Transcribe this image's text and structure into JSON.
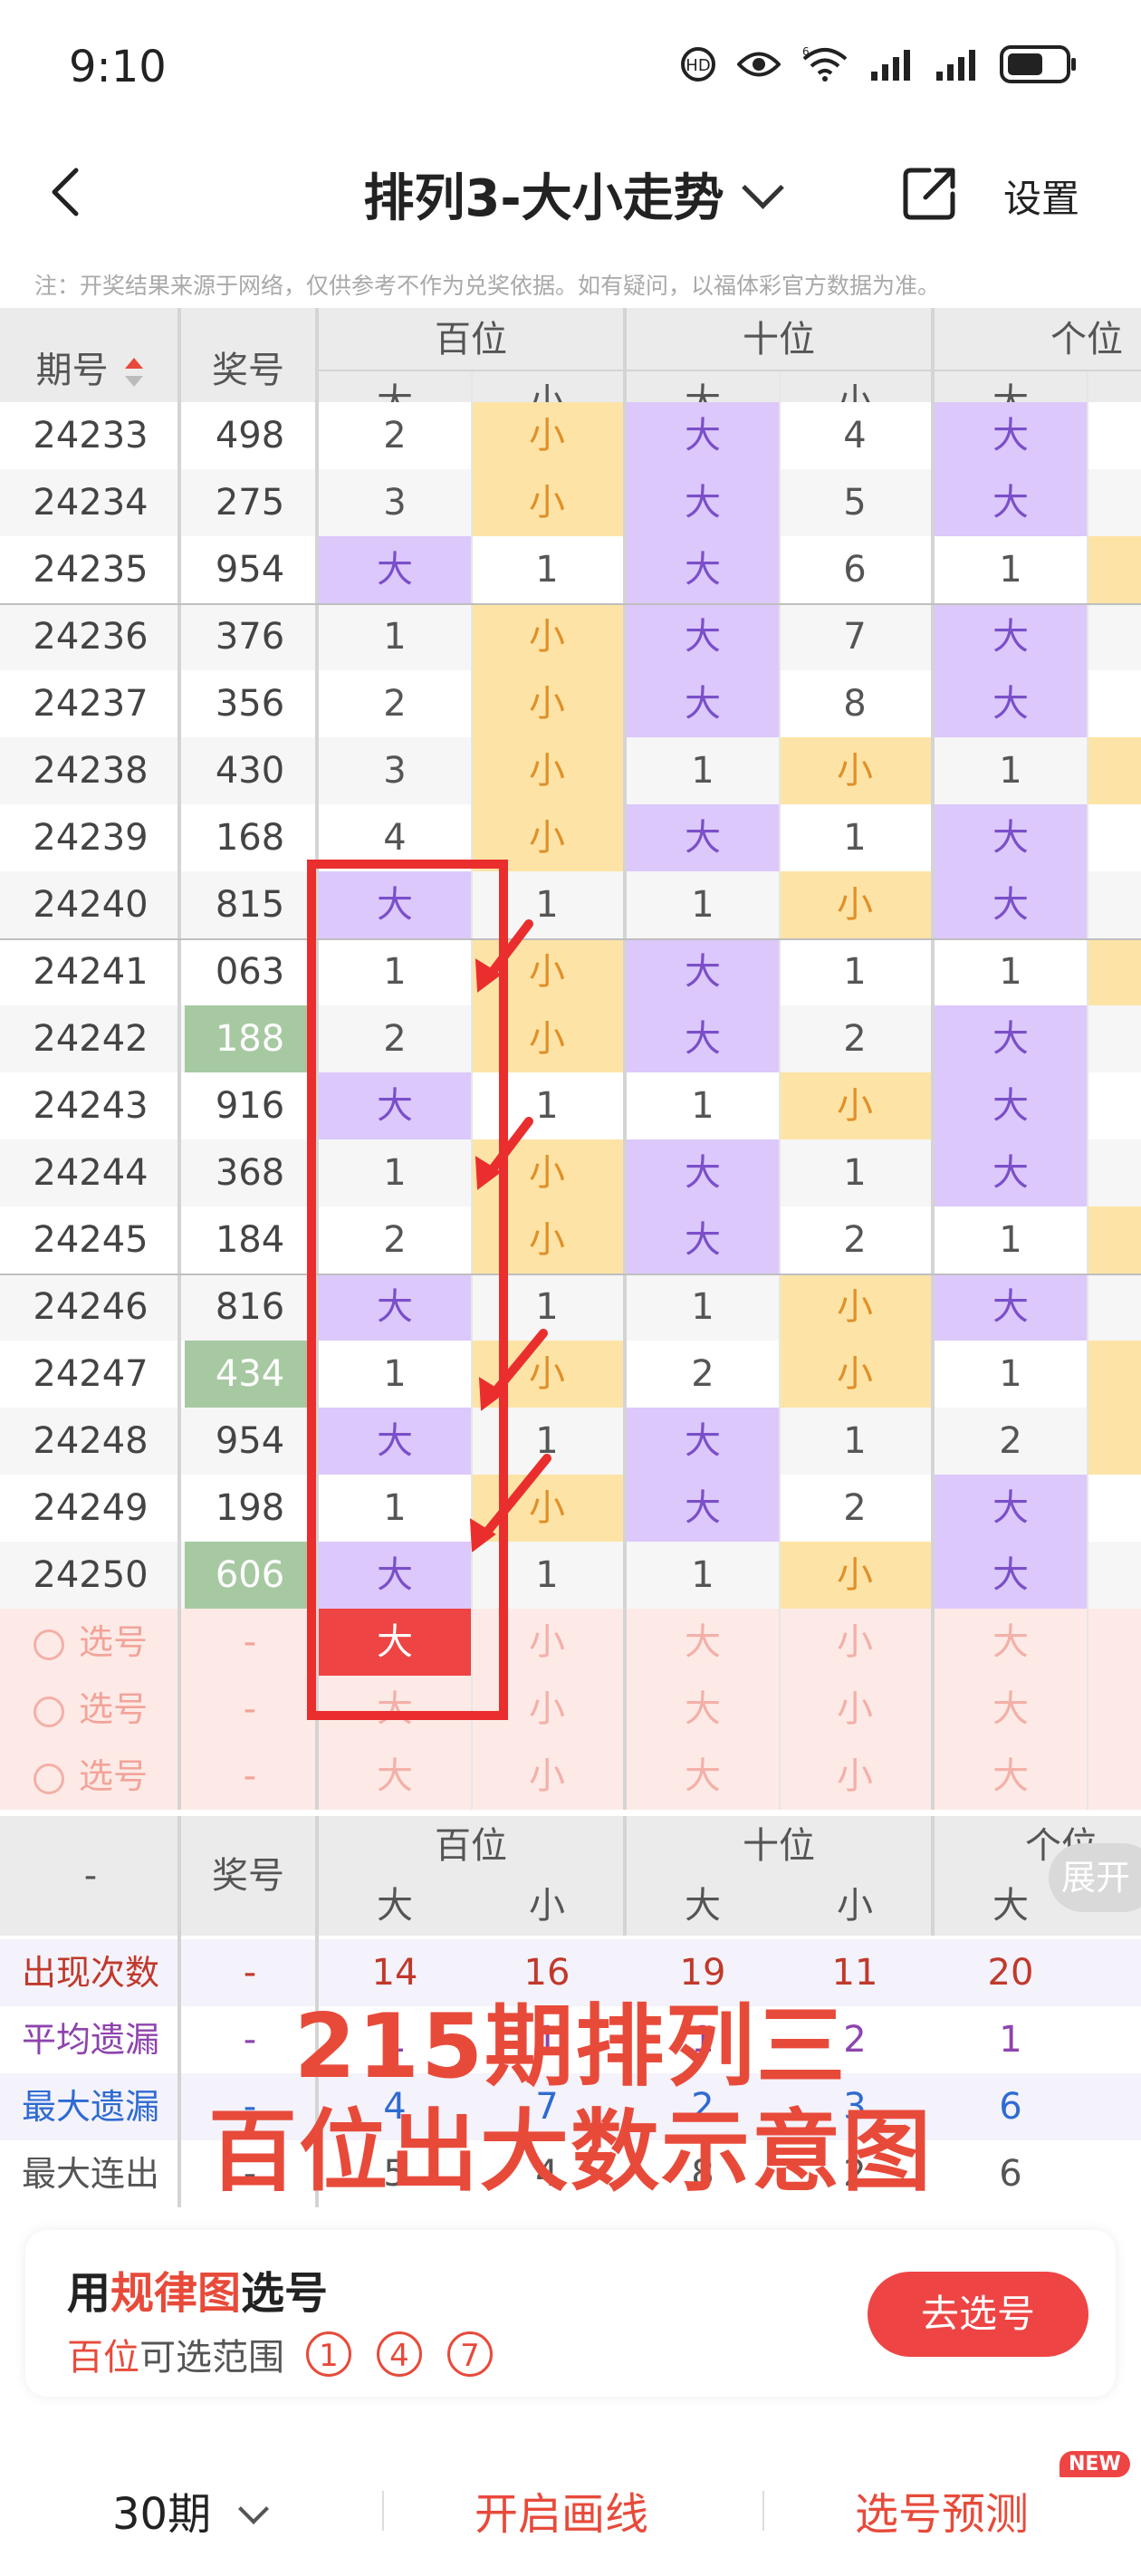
{
  "status": {
    "time": "9:10",
    "network": "6",
    "battery": "battery"
  },
  "nav": {
    "title": "排列3-大小走势",
    "settings": "设置"
  },
  "note": "注：开奖结果来源于网络，仅供参考不作为兑奖依据。如有疑问，以福体彩官方数据为准。",
  "header": {
    "period": "期号",
    "prize": "奖号",
    "groups": [
      "百位",
      "十位",
      "个位"
    ],
    "sub": [
      "大",
      "小",
      "大",
      "小",
      "大"
    ]
  },
  "rows": [
    {
      "p": "24233",
      "n": "498",
      "w": false,
      "c": [
        "2",
        "小",
        "大",
        "4",
        "大"
      ]
    },
    {
      "p": "24234",
      "n": "275",
      "w": false,
      "c": [
        "3",
        "小",
        "大",
        "5",
        "大"
      ]
    },
    {
      "p": "24235",
      "n": "954",
      "w": false,
      "c": [
        "大",
        "1",
        "大",
        "6",
        "1"
      ]
    },
    {
      "p": "24236",
      "n": "376",
      "w": false,
      "c": [
        "1",
        "小",
        "大",
        "7",
        "大"
      ]
    },
    {
      "p": "24237",
      "n": "356",
      "w": false,
      "c": [
        "2",
        "小",
        "大",
        "8",
        "大"
      ]
    },
    {
      "p": "24238",
      "n": "430",
      "w": false,
      "c": [
        "3",
        "小",
        "1",
        "小",
        "1"
      ]
    },
    {
      "p": "24239",
      "n": "168",
      "w": false,
      "c": [
        "4",
        "小",
        "大",
        "1",
        "大"
      ]
    },
    {
      "p": "24240",
      "n": "815",
      "w": false,
      "c": [
        "大",
        "1",
        "1",
        "小",
        "大"
      ]
    },
    {
      "p": "24241",
      "n": "063",
      "w": false,
      "c": [
        "1",
        "小",
        "大",
        "1",
        "1"
      ]
    },
    {
      "p": "24242",
      "n": "188",
      "w": true,
      "c": [
        "2",
        "小",
        "大",
        "2",
        "大"
      ]
    },
    {
      "p": "24243",
      "n": "916",
      "w": false,
      "c": [
        "大",
        "1",
        "1",
        "小",
        "大"
      ]
    },
    {
      "p": "24244",
      "n": "368",
      "w": false,
      "c": [
        "1",
        "小",
        "大",
        "1",
        "大"
      ]
    },
    {
      "p": "24245",
      "n": "184",
      "w": false,
      "c": [
        "2",
        "小",
        "大",
        "2",
        "1"
      ]
    },
    {
      "p": "24246",
      "n": "816",
      "w": false,
      "c": [
        "大",
        "1",
        "1",
        "小",
        "大"
      ]
    },
    {
      "p": "24247",
      "n": "434",
      "w": true,
      "c": [
        "1",
        "小",
        "2",
        "小",
        "1"
      ]
    },
    {
      "p": "24248",
      "n": "954",
      "w": false,
      "c": [
        "大",
        "1",
        "大",
        "1",
        "2"
      ]
    },
    {
      "p": "24249",
      "n": "198",
      "w": false,
      "c": [
        "1",
        "小",
        "大",
        "2",
        "大"
      ]
    },
    {
      "p": "24250",
      "n": "606",
      "w": true,
      "c": [
        "大",
        "1",
        "1",
        "小",
        "大"
      ]
    }
  ],
  "select_rows": [
    {
      "label": "选号",
      "dash": "-",
      "c": [
        "大",
        "小",
        "大",
        "小",
        "大"
      ]
    },
    {
      "label": "选号",
      "dash": "-",
      "c": [
        "大",
        "小",
        "大",
        "小",
        "大"
      ]
    },
    {
      "label": "选号",
      "dash": "-",
      "c": [
        "大",
        "小",
        "大",
        "小",
        "大"
      ]
    }
  ],
  "stats_header": {
    "dash": "-",
    "prize": "奖号",
    "groups": [
      "百位",
      "十位",
      "个位"
    ],
    "sub": [
      "大",
      "小",
      "大",
      "小",
      "大"
    ],
    "expand": "展开"
  },
  "stats": [
    {
      "label": "出现次数",
      "dash": "-",
      "v": [
        "14",
        "16",
        "19",
        "11",
        "20"
      ],
      "color": "#c0392b"
    },
    {
      "label": "平均遗漏",
      "dash": "-",
      "v": [
        "1",
        "1",
        "1",
        "2",
        "1"
      ],
      "color": "#8e44ad"
    },
    {
      "label": "最大遗漏",
      "dash": "-",
      "v": [
        "4",
        "7",
        "2",
        "3",
        "6"
      ],
      "color": "#2e6bd1"
    },
    {
      "label": "最大连出",
      "dash": "-",
      "v": [
        "5",
        "4",
        "8",
        "2",
        "6"
      ],
      "color": "#555555"
    }
  ],
  "overlay": {
    "line1": "215期排列三",
    "line2": "百位出大数示意图"
  },
  "card": {
    "title_pre": "用",
    "title_hl": "规律图",
    "title_post": "选号",
    "sub_hl": "百位",
    "sub_post": "可选范围",
    "nums": [
      "1",
      "4",
      "7"
    ],
    "button": "去选号"
  },
  "footer": {
    "periods": "30期",
    "draw": "开启画线",
    "predict": "选号预测",
    "badge": "NEW"
  }
}
